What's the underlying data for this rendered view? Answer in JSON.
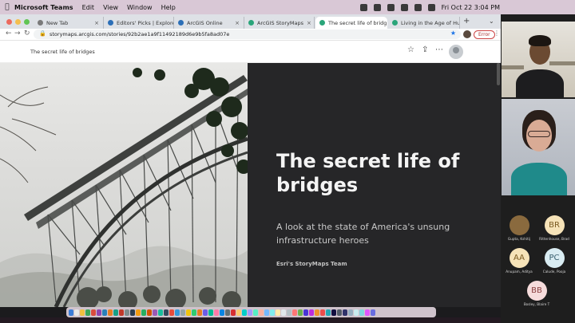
{
  "menubar": {
    "app": "Microsoft Teams",
    "items": [
      "Edit",
      "View",
      "Window",
      "Help"
    ],
    "clock": "Fri Oct 22  3:04 PM"
  },
  "browser": {
    "tabs": [
      {
        "label": "New Tab",
        "color": "#7a7a7a"
      },
      {
        "label": "Editors' Picks | Explore",
        "color": "#2c6fb7"
      },
      {
        "label": "ArcGIS Online",
        "color": "#2c6fb7"
      },
      {
        "label": "ArcGIS StoryMaps",
        "color": "#2aa57a"
      },
      {
        "label": "The secret life of bridg",
        "color": "#2aa57a",
        "active": true
      },
      {
        "label": "Living in the Age of Hur",
        "color": "#2aa57a"
      }
    ],
    "url": "storymaps.arcgis.com/stories/92b2ae1a9f11492189d6e9b5fa8ad07e",
    "error_label": "Error"
  },
  "story": {
    "header_title": "The secret life of bridges",
    "title": "The secret life of bridges",
    "subtitle": "A look at the state of America's unsung infrastructure heroes",
    "byline": "Esri's StoryMaps Team"
  },
  "participants": [
    {
      "initials": "",
      "name": "Gupta, Kshitij",
      "color": "#8a6a3e",
      "photo": true
    },
    {
      "initials": "BR",
      "name": "Rittenhouse, Brad",
      "color": "#f6e3b8",
      "text": "#7a5a20"
    },
    {
      "initials": "AA",
      "name": "Anupam, Aditya",
      "color": "#f6e3b8",
      "text": "#7a5a20"
    },
    {
      "initials": "PC",
      "name": "Calude, Pooja",
      "color": "#d9ecf2",
      "text": "#3a6070"
    },
    {
      "initials": "BB",
      "name": "Bosley, Blaire T",
      "color": "#f6dcdc",
      "text": "#8a4040"
    }
  ]
}
